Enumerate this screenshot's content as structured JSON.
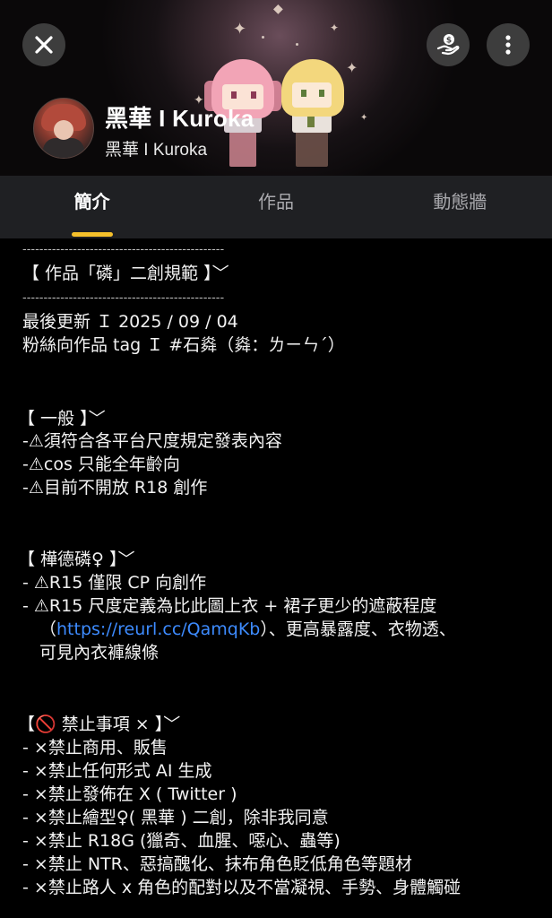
{
  "header": {
    "close_icon": "close-icon",
    "support_icon": "hand-coin-icon",
    "more_icon": "more-vertical-icon",
    "name": "黑華 I Kuroka",
    "handle": "黑華 I Kuroka"
  },
  "tabs": [
    {
      "label": "簡介",
      "active": true
    },
    {
      "label": "作品",
      "active": false
    },
    {
      "label": "動態牆",
      "active": false
    }
  ],
  "content": {
    "divider_top": "------------------------------------------------",
    "title": "【 作品「磷」二創規範 】﹀",
    "divider_bottom": "------------------------------------------------",
    "updated": "最後更新 Ｉ 2025 / 09 / 04",
    "fan_tag": "粉絲向作品 tag Ｉ #石㷠（㷠：ㄌㄧㄣˊ）",
    "general_heading": "【 一般 】﹀",
    "general_items": [
      "-⚠須符合各平台尺度規定發表內容",
      "-⚠cos 只能全年齡向",
      "-⚠目前不開放 R18 創作"
    ],
    "phos_heading": "【 樺德磷♀ 】﹀",
    "phos_items": [
      "- ⚠R15 僅限 CP 向創作",
      "- ⚠R15 尺度定義為比此圖上衣 + 裙子更少的遮蔽程度"
    ],
    "phos_link_prefix": "（",
    "phos_link": "https://reurl.cc/QamqKb",
    "phos_link_suffix": "）、更高暴露度、衣物透、",
    "phos_wrap": "可見內衣褲線條",
    "ban_heading": "【🚫 禁止事項 × 】﹀",
    "ban_items": [
      "- ×禁止商用、販售",
      "- ×禁止任何形式 AI 生成",
      "- ×禁止發佈在 X ( Twitter )",
      "- ×禁止繪型♀( 黑華 ) 二創，除非我同意",
      "- ×禁止 R18G (獵奇、血腥、噁心、蟲等)",
      "- ×禁止 NTR、惡搞醜化、抹布角色貶低角色等題材",
      "- ×禁止路人 x 角色的配對以及不當凝視、手勢、身體觸碰"
    ]
  },
  "colors": {
    "accent": "#f5c02b",
    "link": "#3d8bff",
    "tab_bg": "#1f2023"
  }
}
